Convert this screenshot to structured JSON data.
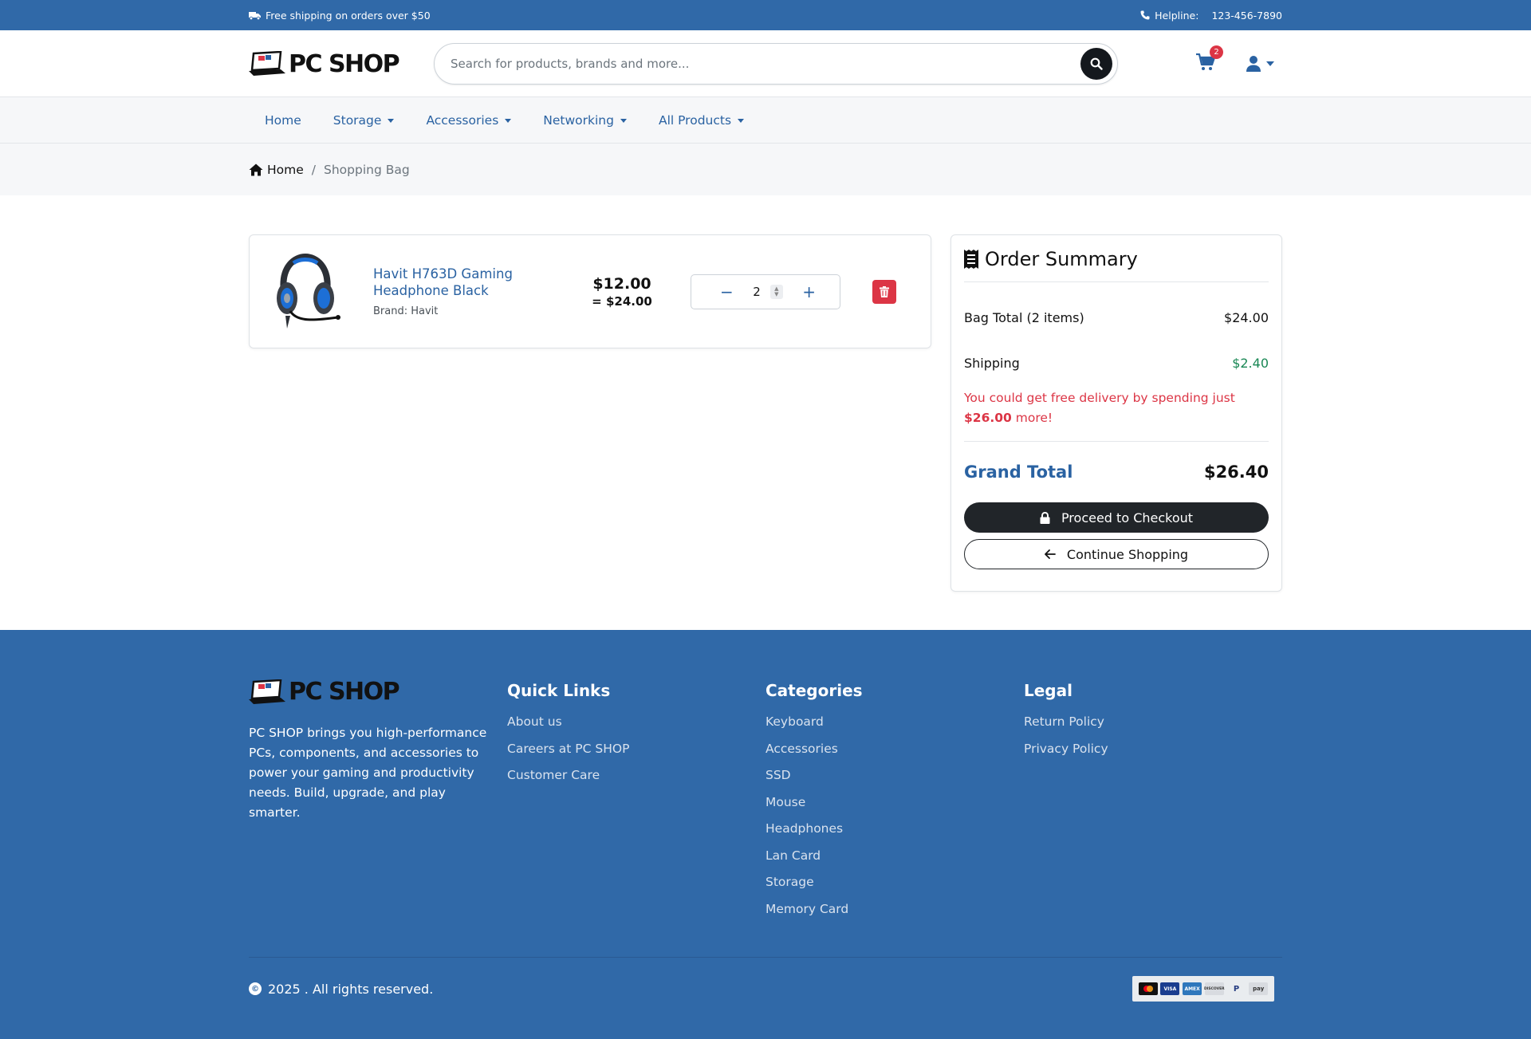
{
  "topbar": {
    "shipping_text": "Free shipping on orders over $50",
    "helpline_label": "Helpline:",
    "helpline_number": "123-456-7890"
  },
  "header": {
    "logo_text": "PC SHOP",
    "search_placeholder": "Search for products, brands and more...",
    "cart_count": "2"
  },
  "nav": {
    "items": [
      {
        "label": "Home",
        "dropdown": false
      },
      {
        "label": "Storage",
        "dropdown": true
      },
      {
        "label": "Accessories",
        "dropdown": true
      },
      {
        "label": "Networking",
        "dropdown": true
      },
      {
        "label": "All Products",
        "dropdown": true
      }
    ]
  },
  "breadcrumb": {
    "home": "Home",
    "separator": "/",
    "current": "Shopping Bag"
  },
  "cart_item": {
    "name": "Havit H763D Gaming Headphone Black",
    "brand": "Brand: Havit",
    "unit_price": "$12.00",
    "line_total": "= $24.00",
    "quantity": "2",
    "minus": "−",
    "plus": "+"
  },
  "summary": {
    "title": "Order Summary",
    "bag_total_label": "Bag Total (2 items)",
    "bag_total_value": "$24.00",
    "shipping_label": "Shipping",
    "shipping_value": "$2.40",
    "promo_prefix": "You could get free delivery by spending just ",
    "promo_amount": "$26.00",
    "promo_suffix": " more!",
    "grand_total_label": "Grand Total",
    "grand_total_value": "$26.40",
    "checkout_label": "Proceed to Checkout",
    "continue_label": "Continue Shopping"
  },
  "footer": {
    "logo_text": "PC SHOP",
    "about": "PC SHOP brings you high-performance PCs, components, and accessories to power your gaming and productivity needs. Build, upgrade, and play smarter.",
    "quick_links": {
      "title": "Quick Links",
      "items": [
        "About us",
        "Careers at PC SHOP",
        "Customer Care"
      ]
    },
    "categories": {
      "title": "Categories",
      "items": [
        "Keyboard",
        "Accessories",
        "SSD",
        "Mouse",
        "Headphones",
        "Lan Card",
        "Storage",
        "Memory Card"
      ]
    },
    "legal": {
      "title": "Legal",
      "items": [
        "Return Policy",
        "Privacy Policy"
      ]
    },
    "copyright": "2025 . All rights reserved.",
    "payment_methods": [
      "mastercard-icon",
      "visa-icon",
      "amex-icon",
      "discover-icon",
      "paypal-icon",
      "pay-icon"
    ]
  },
  "colors": {
    "brand_blue": "#3069a8",
    "link_blue": "#2a62a2",
    "danger": "#dc3545",
    "success": "#198754",
    "dark": "#212529"
  }
}
